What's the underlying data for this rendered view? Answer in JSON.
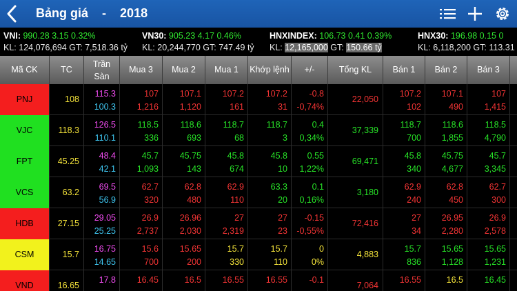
{
  "topbar": {
    "title": "Bảng giá",
    "separator": "-",
    "year": "2018",
    "icons": [
      "back-chevron-icon",
      "list-icon",
      "plus-icon",
      "gear-icon"
    ]
  },
  "indices": [
    {
      "name": "VNI:",
      "value": "990.28",
      "change": "3.15",
      "pct": "0.32%",
      "kl_label": "KL:",
      "kl": "124,076,694",
      "gt_label": "GT:",
      "gt": "7,518.36 tỷ"
    },
    {
      "name": "VN30:",
      "value": "905.23",
      "change": "4.17",
      "pct": "0.46%",
      "kl_label": "KL:",
      "kl": "20,244,770",
      "gt_label": "GT:",
      "gt": "747.49 tỷ"
    },
    {
      "name": "HNXINDEX:",
      "value": "106.73",
      "change": "0.41",
      "pct": "0.39%",
      "kl_label": "KL:",
      "kl": "12,165,000",
      "gt_label": "GT:",
      "gt": "150.66 tỷ"
    },
    {
      "name": "HNX30:",
      "value": "196.98",
      "change": "0.15",
      "pct": "0",
      "kl_label": "KL:",
      "kl": "6,118,200",
      "gt_label": "GT:",
      "gt": "113.31"
    }
  ],
  "header": {
    "ma_ck": "Mã CK",
    "tc": "TC",
    "tran": "Trần",
    "san": "Sàn",
    "mua3": "Mua 3",
    "mua2": "Mua 2",
    "mua1": "Mua 1",
    "khop": "Khớp lệnh",
    "pm": "+/-",
    "tongkl": "Tổng KL",
    "ban1": "Bán 1",
    "ban2": "Bán 2",
    "ban3": "Bán 3"
  },
  "colors": {
    "up": "#27e327",
    "down": "#f23434",
    "ref": "#f5e43a",
    "ceiling": "#f04cf0",
    "floor": "#3fc7f2",
    "header_bar": "#1f64b8"
  },
  "rows": [
    {
      "sym": "PNJ",
      "sym_bg": "red",
      "tc": "108",
      "tran": "115.3",
      "san": "100.3",
      "mua3_p": "107",
      "mua3_v": "1,216",
      "mua2_p": "107.1",
      "mua2_v": "1,120",
      "mua1_p": "107.2",
      "mua1_v": "161",
      "khop_p": "107.2",
      "khop_v": "31",
      "pm": "-0.8",
      "pm_pct": "-0,74%",
      "tongkl": "22,050",
      "ban1_p": "107.2",
      "ban1_v": "102",
      "ban2_p": "107.1",
      "ban2_v": "490",
      "ban3_p": "107",
      "ban3_v": "1,415",
      "cl": {
        "mua3": "red",
        "mua2": "red",
        "mua1": "red",
        "khop": "red",
        "ban1": "red",
        "ban2": "red",
        "ban3": "red"
      }
    },
    {
      "sym": "VJC",
      "sym_bg": "green",
      "tc": "118.3",
      "tran": "126.5",
      "san": "110.1",
      "mua3_p": "118.5",
      "mua3_v": "336",
      "mua2_p": "118.6",
      "mua2_v": "693",
      "mua1_p": "118.7",
      "mua1_v": "68",
      "khop_p": "118.7",
      "khop_v": "3",
      "pm": "0.4",
      "pm_pct": "0,34%",
      "tongkl": "37,339",
      "ban1_p": "118.7",
      "ban1_v": "700",
      "ban2_p": "118.6",
      "ban2_v": "1,855",
      "ban3_p": "118.5",
      "ban3_v": "4,790",
      "cl": {
        "mua3": "grn",
        "mua2": "grn",
        "mua1": "grn",
        "khop": "grn",
        "ban1": "grn",
        "ban2": "grn",
        "ban3": "grn"
      }
    },
    {
      "sym": "FPT",
      "sym_bg": "green",
      "tc": "45.25",
      "tran": "48.4",
      "san": "42.1",
      "mua3_p": "45.7",
      "mua3_v": "1,093",
      "mua2_p": "45.75",
      "mua2_v": "143",
      "mua1_p": "45.8",
      "mua1_v": "674",
      "khop_p": "45.8",
      "khop_v": "10",
      "pm": "0.55",
      "pm_pct": "1,22%",
      "tongkl": "69,471",
      "ban1_p": "45.8",
      "ban1_v": "340",
      "ban2_p": "45.75",
      "ban2_v": "4,677",
      "ban3_p": "45.7",
      "ban3_v": "3,345",
      "cl": {
        "mua3": "grn",
        "mua2": "grn",
        "mua1": "grn",
        "khop": "grn",
        "ban1": "grn",
        "ban2": "grn",
        "ban3": "grn"
      }
    },
    {
      "sym": "VCS",
      "sym_bg": "green",
      "tc": "63.2",
      "tran": "69.5",
      "san": "56.9",
      "mua3_p": "62.7",
      "mua3_v": "320",
      "mua2_p": "62.8",
      "mua2_v": "480",
      "mua1_p": "62.9",
      "mua1_v": "110",
      "khop_p": "63.3",
      "khop_v": "20",
      "pm": "0.1",
      "pm_pct": "0,16%",
      "tongkl": "3,180",
      "ban1_p": "62.9",
      "ban1_v": "240",
      "ban2_p": "62.8",
      "ban2_v": "450",
      "ban3_p": "62.7",
      "ban3_v": "300",
      "cl": {
        "mua3": "red",
        "mua2": "red",
        "mua1": "red",
        "khop": "grn",
        "ban1": "red",
        "ban2": "red",
        "ban3": "red"
      }
    },
    {
      "sym": "HDB",
      "sym_bg": "red",
      "tc": "27.15",
      "tran": "29.05",
      "san": "25.25",
      "mua3_p": "26.9",
      "mua3_v": "2,737",
      "mua2_p": "26.96",
      "mua2_v": "2,030",
      "mua1_p": "27",
      "mua1_v": "2,319",
      "khop_p": "27",
      "khop_v": "23",
      "pm": "-0.15",
      "pm_pct": "-0,55%",
      "tongkl": "72,416",
      "ban1_p": "27",
      "ban1_v": "34",
      "ban2_p": "26.95",
      "ban2_v": "2,280",
      "ban3_p": "26.9",
      "ban3_v": "2,578",
      "cl": {
        "mua3": "red",
        "mua2": "red",
        "mua1": "red",
        "khop": "red",
        "ban1": "red",
        "ban2": "red",
        "ban3": "red"
      }
    },
    {
      "sym": "CSM",
      "sym_bg": "yellow",
      "tc": "15.7",
      "tran": "16.75",
      "san": "14.65",
      "mua3_p": "15.6",
      "mua3_v": "700",
      "mua2_p": "15.65",
      "mua2_v": "200",
      "mua1_p": "15.7",
      "mua1_v": "330",
      "khop_p": "15.7",
      "khop_v": "110",
      "pm": "0",
      "pm_pct": "0%",
      "tongkl": "4,883",
      "ban1_p": "15.7",
      "ban1_v": "836",
      "ban2_p": "15.65",
      "ban2_v": "1,128",
      "ban3_p": "15.65",
      "ban3_v": "1,231",
      "cl": {
        "mua3": "red",
        "mua2": "red",
        "mua1": "yel",
        "khop": "yel",
        "ban1": "grn",
        "ban2": "grn",
        "ban3": "grn"
      }
    },
    {
      "sym": "VND",
      "sym_bg": "red",
      "tc": "16.65",
      "tran": "17.8",
      "san": "",
      "mua3_p": "16.45",
      "mua3_v": "",
      "mua2_p": "16.5",
      "mua2_v": "",
      "mua1_p": "16.55",
      "mua1_v": "",
      "khop_p": "16.55",
      "khop_v": "",
      "pm": "-0.1",
      "pm_pct": "",
      "tongkl": "7,064",
      "ban1_p": "16.55",
      "ban1_v": "",
      "ban2_p": "16.5",
      "ban2_v": "",
      "ban3_p": "16.45",
      "ban3_v": "",
      "cl": {
        "mua3": "red",
        "mua2": "red",
        "mua1": "red",
        "khop": "red",
        "ban1": "red",
        "ban2": "yel",
        "ban3": "grn"
      }
    }
  ]
}
